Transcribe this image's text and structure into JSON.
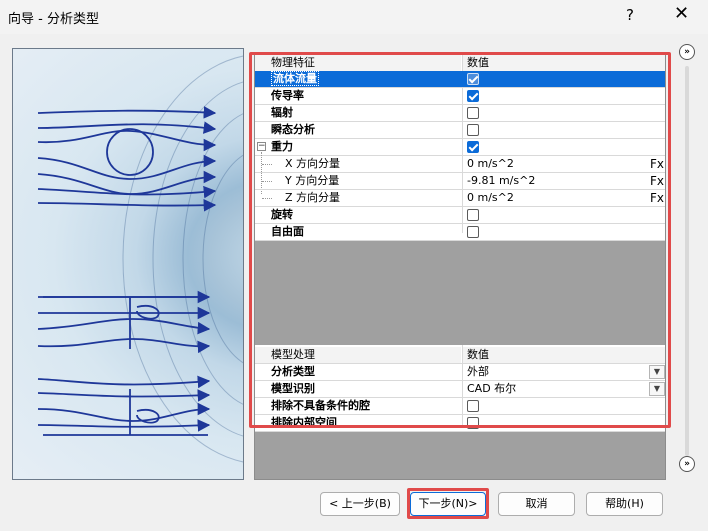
{
  "window": {
    "title": "向导 - 分析类型",
    "help_glyph": "?",
    "close_glyph": "✕"
  },
  "physics_grid": {
    "header": {
      "name": "物理特征",
      "value": "数值"
    },
    "rows": [
      {
        "name": "流体流量",
        "value": "",
        "control": "checkbox",
        "checked": true,
        "selected": true
      },
      {
        "name": "传导率",
        "value": "",
        "control": "checkbox",
        "checked": true
      },
      {
        "name": "辐射",
        "value": "",
        "control": "checkbox",
        "checked": false
      },
      {
        "name": "瞬态分析",
        "value": "",
        "control": "checkbox",
        "checked": false
      },
      {
        "name": "重力",
        "value": "",
        "control": "checkbox",
        "checked": true,
        "expander": "−"
      },
      {
        "name": "X 方向分量",
        "value": "0 m/s^2",
        "control": "fx",
        "fx_label": "Fx"
      },
      {
        "name": "Y 方向分量",
        "value": "-9.81 m/s^2",
        "control": "fx",
        "fx_label": "Fx"
      },
      {
        "name": "Z 方向分量",
        "value": "0 m/s^2",
        "control": "fx",
        "fx_label": "Fx"
      },
      {
        "name": "旋转",
        "value": "",
        "control": "checkbox",
        "checked": false
      },
      {
        "name": "自由面",
        "value": "",
        "control": "checkbox",
        "checked": false
      }
    ]
  },
  "model_grid": {
    "header": {
      "name": "模型处理",
      "value": "数值"
    },
    "rows": [
      {
        "name": "分析类型",
        "value": "外部",
        "control": "dropdown"
      },
      {
        "name": "模型识别",
        "value": "CAD 布尔",
        "control": "dropdown"
      },
      {
        "name": "排除不具备条件的腔",
        "value": "",
        "control": "checkbox",
        "checked": false
      },
      {
        "name": "排除内部空间",
        "value": "",
        "control": "checkbox",
        "checked": false
      }
    ]
  },
  "scroll": {
    "up_glyph": "»",
    "down_glyph": "»"
  },
  "buttons": {
    "back": "< 上一步(B)",
    "next": "下一步(N)>",
    "cancel": "取消",
    "help": "帮助(H)"
  },
  "colors": {
    "accent": "#0b6bd8",
    "highlight": "#e04a4a",
    "panel_gray": "#a0a0a0"
  }
}
